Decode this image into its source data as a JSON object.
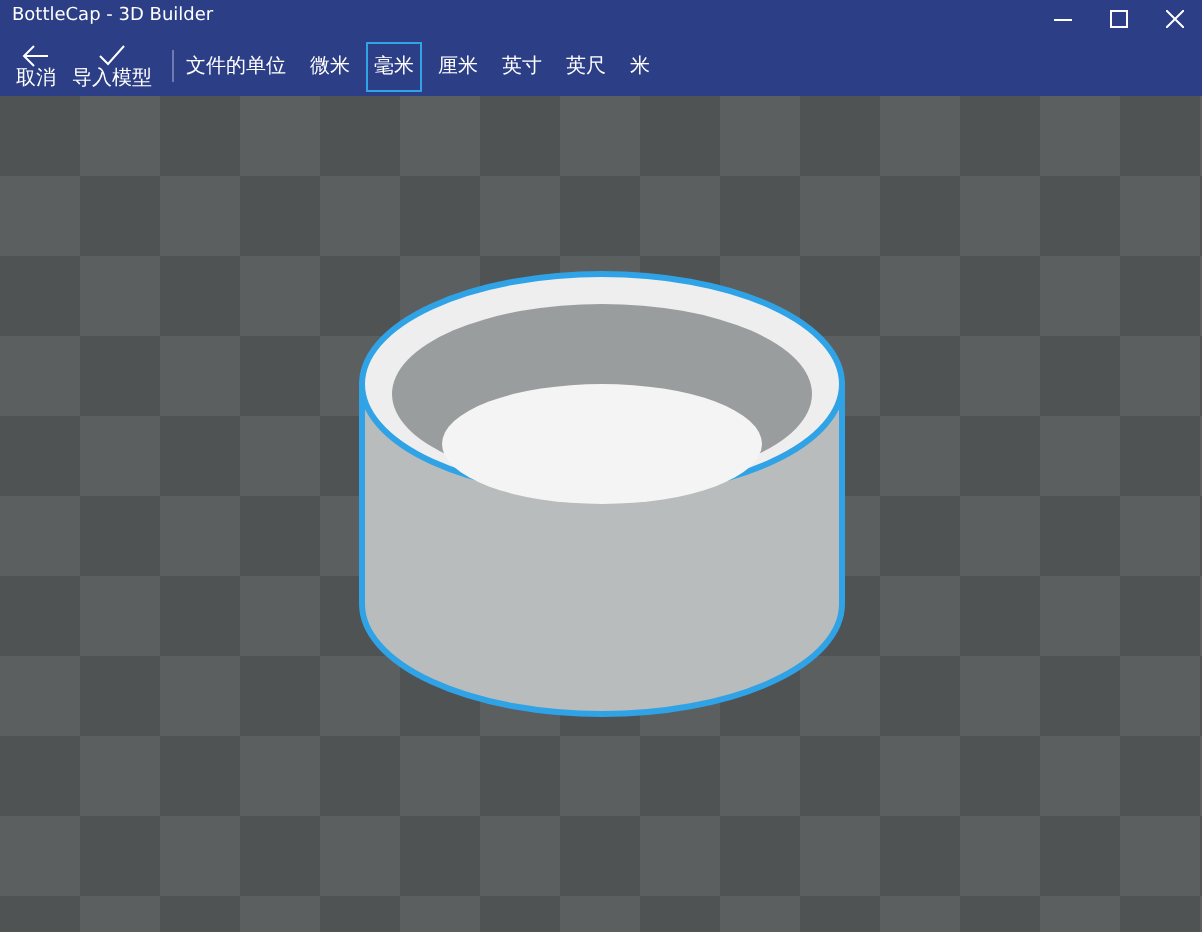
{
  "window": {
    "title": "BottleCap - 3D Builder"
  },
  "toolbar": {
    "actions": [
      {
        "kind": "back",
        "label": "取消"
      },
      {
        "kind": "check",
        "label": "导入模型"
      }
    ],
    "units_label": "文件的单位",
    "units": [
      {
        "label": "微米",
        "selected": false
      },
      {
        "label": "毫米",
        "selected": true
      },
      {
        "label": "厘米",
        "selected": false
      },
      {
        "label": "英寸",
        "selected": false
      },
      {
        "label": "英尺",
        "selected": false
      },
      {
        "label": "米",
        "selected": false
      }
    ]
  }
}
